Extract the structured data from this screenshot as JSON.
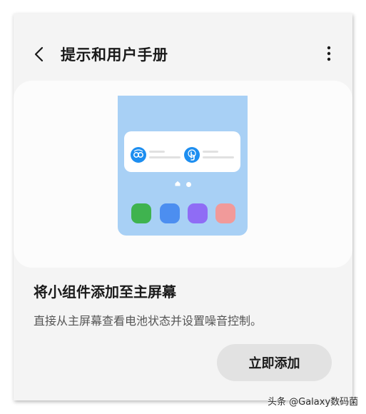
{
  "header": {
    "back_icon": "chevron-left-icon",
    "title": "提示和用户手册",
    "more_icon": "more-vertical-icon"
  },
  "illustration": {
    "widget_icons": [
      "earbuds-icon",
      "touch-icon"
    ],
    "app_icon_colors": [
      "#3fb34f",
      "#4c8ef0",
      "#8f6cf5",
      "#f19a9a"
    ],
    "page_indicator": [
      "home",
      "dot"
    ]
  },
  "content": {
    "heading": "将小组件添加至主屏幕",
    "description": "直接从主屏幕查看电池状态并设置噪音控制。",
    "add_button_label": "立即添加"
  },
  "watermark": "头条 @Galaxy数码菌",
  "colors": {
    "accent": "#1d8ef0",
    "phone_background": "#a8d0f5",
    "page_background": "#f4f4f4",
    "button_background": "#e2e2e2"
  }
}
